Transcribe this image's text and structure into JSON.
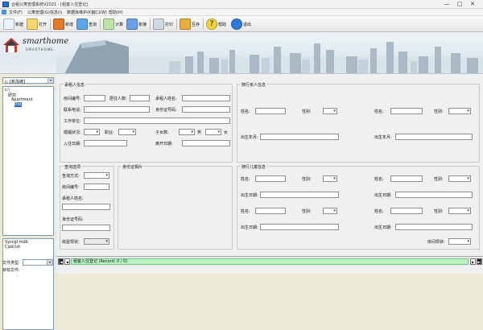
{
  "window": {
    "title": "合租公寓管理系统V2021 - [租客入住登记]",
    "minimize": "—",
    "maximize": "□",
    "close": "✕"
  },
  "menu": [
    "文件(F)",
    "公寓管理(G)",
    "信息(I)",
    "数据库维护(K)",
    "窗口(W)",
    "帮助(H)"
  ],
  "toolbar": [
    {
      "label": "新建",
      "icon": "new-doc-icon",
      "color": "#e9f2ff"
    },
    {
      "label": "打开",
      "icon": "open-folder-icon",
      "color": "#f6d56a"
    },
    {
      "label": "新增",
      "icon": "add-user-icon",
      "color": "#e57a2b"
    },
    {
      "label": "查询",
      "icon": "magnifier-icon",
      "color": "#5aa6e8"
    },
    {
      "label": "计算",
      "icon": "calculator-icon",
      "color": "#bfe3a6"
    },
    {
      "label": "账簿",
      "icon": "ledger-icon",
      "color": "#6aa0e6"
    },
    {
      "label": "打印",
      "icon": "printer-icon",
      "color": "#cfd8e3"
    },
    {
      "label": "互存",
      "icon": "exchange-icon",
      "color": "#e8ad3a"
    },
    {
      "label": "帮助",
      "icon": "help-icon",
      "color": "#f3d23a"
    },
    {
      "label": "退出",
      "icon": "exit-icon",
      "color": "#2f7ad8"
    }
  ],
  "logo": {
    "name": "smarthome",
    "sub": "SMARTHOME"
  },
  "left": {
    "drive": "c: [新加坡]",
    "tree": [
      "c:\\",
      "研究",
      "Apartment",
      "Rtd"
    ],
    "files": [
      "Syscgl.mdb",
      "Cjsd.txt"
    ],
    "file_type_label": "文件类型:",
    "dir_label": "目标文件:"
  },
  "tenant": {
    "title": "承租人信息",
    "room_no": "房间编号:",
    "occupants": "居住人数:",
    "tenant_name": "承租人姓名:",
    "phone": "联系电话:",
    "id_no": "身份证号码:",
    "work": "工作单位:",
    "marital": "婚姻状况:",
    "job": "职业:",
    "children": "子女数:",
    "male": "男",
    "female": "女",
    "checkin": "入住日期:",
    "checkout": "离开日期:"
  },
  "companion": {
    "title": "随行亲人信息",
    "name": "姓名:",
    "gender": "性别:",
    "birth": "出生年月:"
  },
  "query": {
    "title": "查询选项",
    "method": "查询方式:",
    "room_no": "房间编号:",
    "tenant_name": "承租人姓名:",
    "id_no": "身份证号码:",
    "room_status": "房屋现状:"
  },
  "idphoto": {
    "title": "身份证相片"
  },
  "children": {
    "title": "随行儿童信息",
    "name": "姓名:",
    "gender": "性别:",
    "birth": "出生日期:",
    "room_status": "房间现状:"
  },
  "status": {
    "record": "租客入住登记 (Record: 0 / 0)"
  }
}
